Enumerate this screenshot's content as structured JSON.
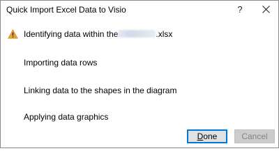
{
  "dialog": {
    "title": "Quick Import Excel Data to Visio",
    "help_label": "?",
    "close_icon": "close-icon"
  },
  "steps": [
    {
      "label_prefix": "Identifying data within the",
      "filename_suffix": ".xlsx",
      "icon": "warning-icon",
      "icon_color": "#e8a33b"
    },
    {
      "label": "Importing data rows"
    },
    {
      "label": "Linking data to the shapes in the diagram"
    },
    {
      "label": "Applying data graphics"
    }
  ],
  "buttons": {
    "done_access_key": "D",
    "done_rest": "one",
    "cancel_label": "Cancel"
  },
  "colors": {
    "focus_border": "#0078d7",
    "disabled_text": "#838383"
  }
}
